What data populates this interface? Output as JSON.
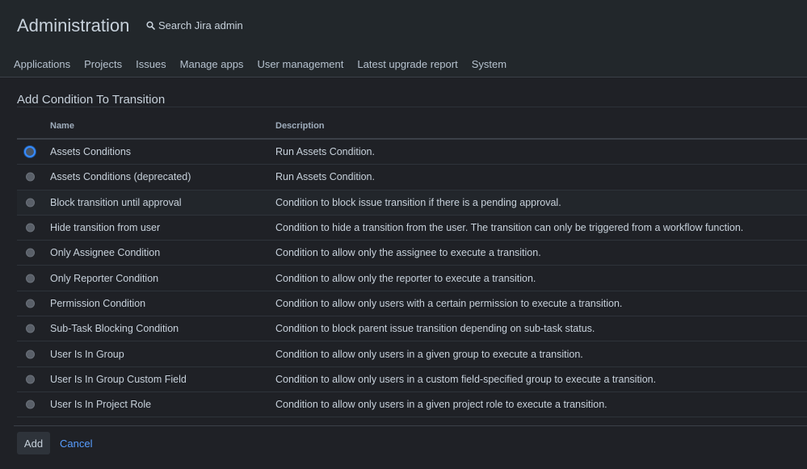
{
  "header": {
    "title": "Administration",
    "search_placeholder": "Search Jira admin",
    "search_icon": "search-icon"
  },
  "tabs": [
    {
      "label": "Applications"
    },
    {
      "label": "Projects"
    },
    {
      "label": "Issues"
    },
    {
      "label": "Manage apps"
    },
    {
      "label": "User management"
    },
    {
      "label": "Latest upgrade report"
    },
    {
      "label": "System"
    }
  ],
  "page": {
    "heading": "Add Condition To Transition"
  },
  "table": {
    "columns": {
      "name": "Name",
      "description": "Description"
    },
    "selected_index": 0,
    "rows": [
      {
        "name": "Assets Conditions",
        "description": "Run Assets Condition."
      },
      {
        "name": "Assets Conditions (deprecated)",
        "description": "Run Assets Condition."
      },
      {
        "name": "Block transition until approval",
        "description": "Condition to block issue transition if there is a pending approval."
      },
      {
        "name": "Hide transition from user",
        "description": "Condition to hide a transition from the user. The transition can only be triggered from a workflow function."
      },
      {
        "name": "Only Assignee Condition",
        "description": "Condition to allow only the assignee to execute a transition."
      },
      {
        "name": "Only Reporter Condition",
        "description": "Condition to allow only the reporter to execute a transition."
      },
      {
        "name": "Permission Condition",
        "description": "Condition to allow only users with a certain permission to execute a transition."
      },
      {
        "name": "Sub-Task Blocking Condition",
        "description": "Condition to block parent issue transition depending on sub-task status."
      },
      {
        "name": "User Is In Group",
        "description": "Condition to allow only users in a given group to execute a transition."
      },
      {
        "name": "User Is In Group Custom Field",
        "description": "Condition to allow only users in a custom field-specified group to execute a transition."
      },
      {
        "name": "User Is In Project Role",
        "description": "Condition to allow only users in a given project role to execute a transition."
      }
    ]
  },
  "actions": {
    "add_label": "Add",
    "cancel_label": "Cancel"
  },
  "colors": {
    "background": "#1f2126",
    "text": "#c7d1db",
    "link": "#579dff",
    "radio_selected": "#388bff"
  }
}
